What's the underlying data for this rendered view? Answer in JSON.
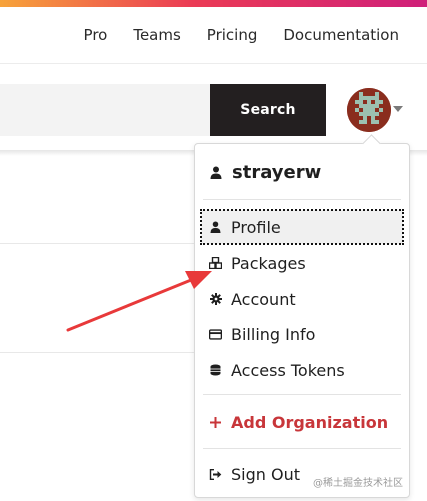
{
  "nav": {
    "links": [
      "Pro",
      "Teams",
      "Pricing",
      "Documentation"
    ]
  },
  "search": {
    "button_label": "Search"
  },
  "colors": {
    "accent_gradient_start": "#f7a33a",
    "accent_gradient_end": "#cf1f7a",
    "search_button_bg": "#231f20",
    "add_org_red": "#c8363a",
    "annotation_arrow": "#e8393a"
  },
  "dropdown": {
    "username": "strayerw",
    "items": [
      {
        "label": "Profile",
        "icon": "user-icon",
        "active": true
      },
      {
        "label": "Packages",
        "icon": "packages-icon"
      },
      {
        "label": "Account",
        "icon": "gear-icon"
      },
      {
        "label": "Billing Info",
        "icon": "credit-card-icon"
      },
      {
        "label": "Access Tokens",
        "icon": "coins-icon"
      }
    ],
    "add_org_label": "Add Organization",
    "sign_out_label": "Sign Out"
  },
  "watermark": "@稀土掘金技术社区"
}
